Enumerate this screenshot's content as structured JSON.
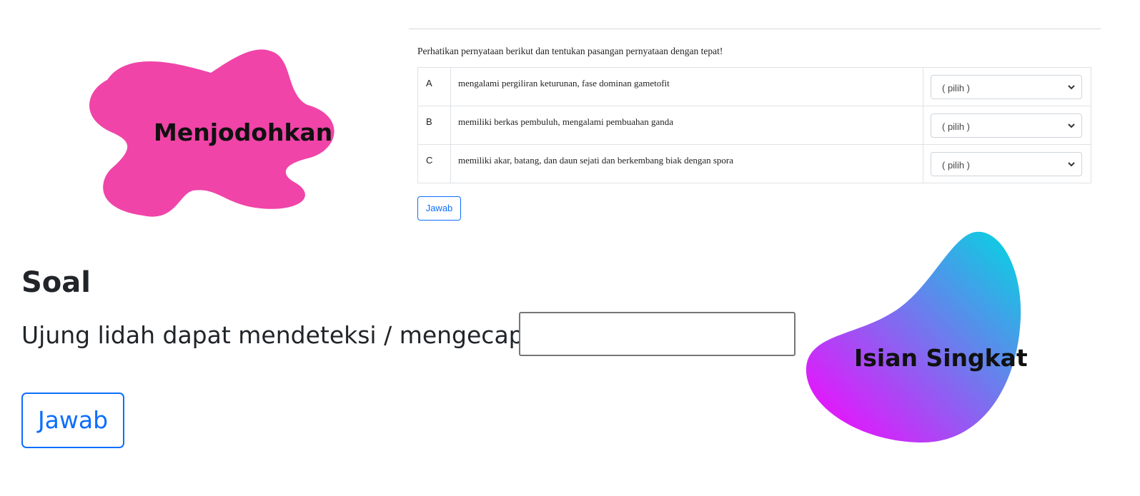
{
  "matching": {
    "badge_label": "Menjodohkan",
    "badge_color": "#f044a8",
    "instruction": "Perhatikan pernyataan berikut dan tentukan pasangan pernyataan dengan tepat!",
    "rows": [
      {
        "letter": "A",
        "statement": "mengalami pergiliran keturunan, fase dominan gametofit",
        "selected": "( pilih )"
      },
      {
        "letter": "B",
        "statement": "memiliki berkas pembuluh, mengalami pembuahan ganda",
        "selected": "( pilih )"
      },
      {
        "letter": "C",
        "statement": "memiliki akar, batang, dan daun sejati dan berkembang biak dengan spora",
        "selected": "( pilih )"
      }
    ],
    "submit_label": "Jawab"
  },
  "short_answer": {
    "badge_label": "Isian Singkat",
    "badge_gradient": [
      "#ff00ff",
      "#00d8e0"
    ],
    "heading": "Soal",
    "question": "Ujung lidah dapat mendeteksi / mengecap rasa",
    "input_value": "",
    "submit_label": "Jawab"
  },
  "colors": {
    "primary": "#0d6efd",
    "text": "#212529",
    "border": "#dee2e6"
  }
}
